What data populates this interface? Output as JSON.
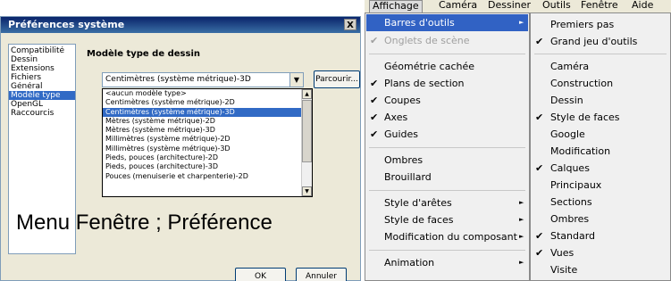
{
  "dialog": {
    "title": "Préférences système",
    "close_label": "X",
    "categories": [
      "Compatibilité",
      "Dessin",
      "Extensions",
      "Fichiers",
      "Général",
      "Modèle type",
      "OpenGL",
      "Raccourcis"
    ],
    "selected_category": "Modèle type",
    "section_title": "Modèle type de dessin",
    "selected_template": "Centimètres (système métrique)-3D",
    "browse_label": "Parcourir...",
    "template_options": [
      "<aucun modèle type>",
      "Centimètres (système métrique)-2D",
      "Centimètres (système métrique)-3D",
      "Mètres (système métrique)-2D",
      "Mètres (système métrique)-3D",
      "Millimètres (système métrique)-2D",
      "Millimètres (système métrique)-3D",
      "Pieds, pouces (architecture)-2D",
      "Pieds, pouces (architecture)-3D",
      "Pouces (menuiserie et charpenterie)-2D"
    ],
    "ok_label": "OK",
    "cancel_label": "Annuler"
  },
  "caption": "Menu Fenêtre ; Préférence",
  "menubar": [
    "Affichage",
    "Caméra",
    "Dessiner",
    "Outils",
    "Fenêtre",
    "Aide"
  ],
  "view_menu": [
    {
      "label": "Barres d'outils",
      "submenu": true,
      "selected": true
    },
    {
      "label": "Onglets de scène",
      "checked": true,
      "disabled": true
    },
    {
      "label": "Géométrie cachée"
    },
    {
      "label": "Plans de section",
      "checked": true
    },
    {
      "label": "Coupes",
      "checked": true
    },
    {
      "label": "Axes",
      "checked": true
    },
    {
      "label": "Guides",
      "checked": true
    },
    {
      "label": "Ombres"
    },
    {
      "label": "Brouillard"
    },
    {
      "label": "Style d'arêtes",
      "submenu": true
    },
    {
      "label": "Style de faces",
      "submenu": true
    },
    {
      "label": "Modification du composant",
      "submenu": true
    },
    {
      "label": "Animation",
      "submenu": true
    }
  ],
  "toolbars_menu": [
    {
      "label": "Premiers pas"
    },
    {
      "label": "Grand jeu d'outils",
      "checked": true
    },
    {
      "label": "Caméra"
    },
    {
      "label": "Construction"
    },
    {
      "label": "Dessin"
    },
    {
      "label": "Style de faces",
      "checked": true
    },
    {
      "label": "Google"
    },
    {
      "label": "Modification"
    },
    {
      "label": "Calques",
      "checked": true
    },
    {
      "label": "Principaux"
    },
    {
      "label": "Sections"
    },
    {
      "label": "Ombres"
    },
    {
      "label": "Standard",
      "checked": true
    },
    {
      "label": "Vues",
      "checked": true
    },
    {
      "label": "Visite"
    }
  ],
  "glyphs": {
    "check": "✔",
    "arrow": "►",
    "scroll_up": "▲",
    "scroll_down": "▼"
  }
}
